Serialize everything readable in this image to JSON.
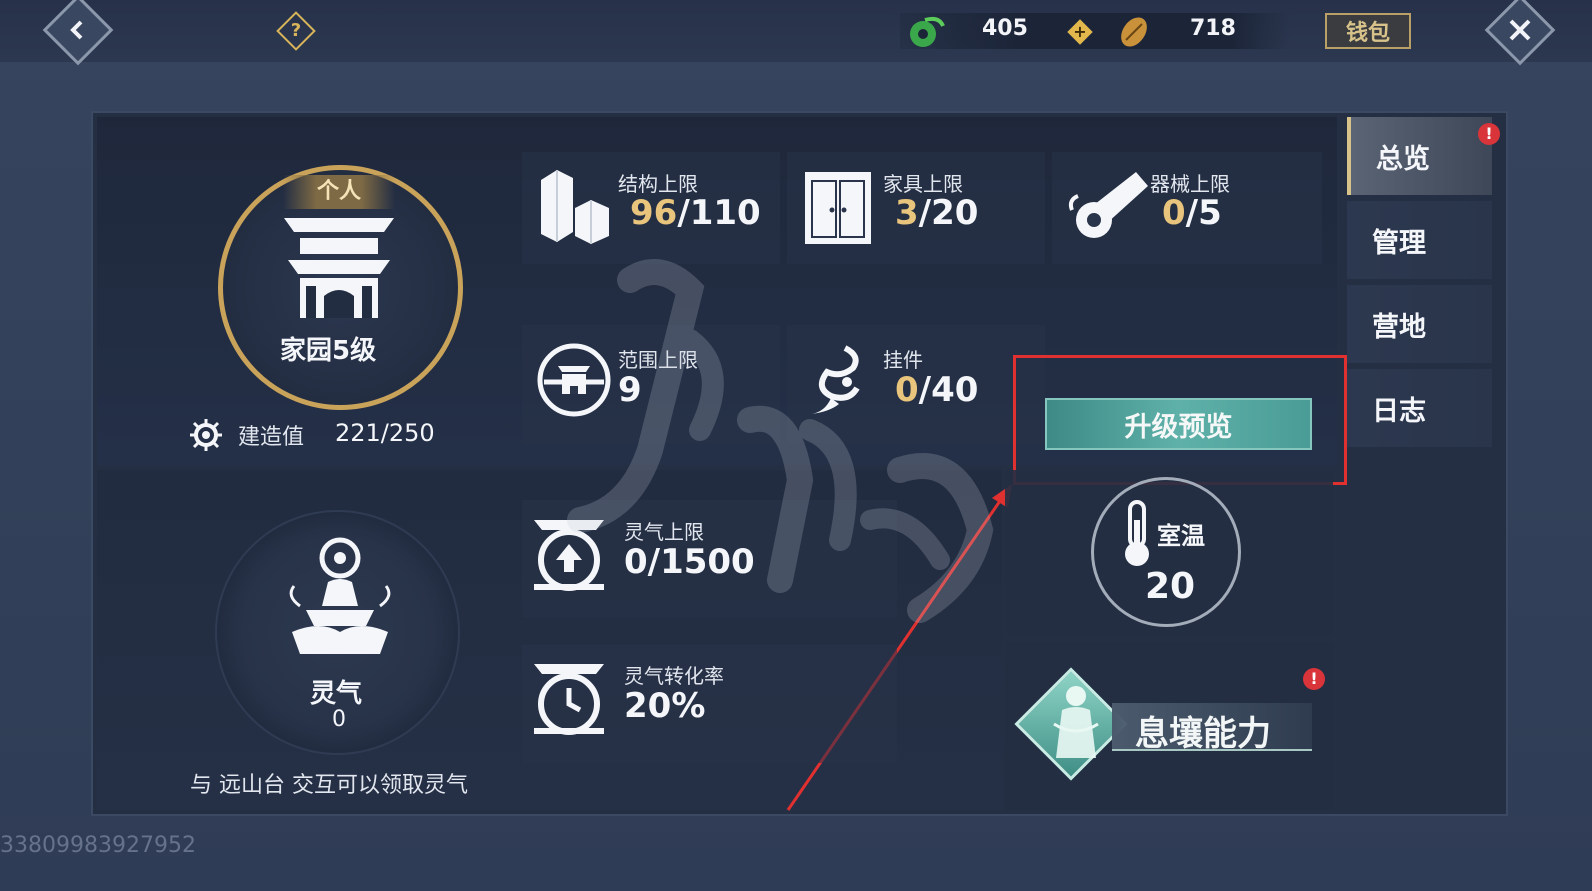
{
  "currency": {
    "jade": "405",
    "coin": "718",
    "wallet_label": "钱包"
  },
  "home": {
    "tag": "个人",
    "level_label": "家园5级",
    "build_label": "建造值",
    "build_value": "221/250"
  },
  "stats": {
    "structure": {
      "label": "结构上限",
      "current": "96",
      "max": "/110"
    },
    "furniture": {
      "label": "家具上限",
      "current": "3",
      "max": "/20"
    },
    "machine": {
      "label": "器械上限",
      "current": "0",
      "max": "/5"
    },
    "range": {
      "label": "范围上限",
      "value": "9"
    },
    "pendant": {
      "label": "挂件",
      "current": "0",
      "max": "/40"
    },
    "aura_cap": {
      "label": "灵气上限",
      "value": "0/1500"
    },
    "aura_rate": {
      "label": "灵气转化率",
      "value": "20%"
    }
  },
  "aura": {
    "label": "灵气",
    "value": "0",
    "hint": "与 远山台 交互可以领取灵气"
  },
  "upgrade_preview_label": "升级预览",
  "temperature": {
    "label": "室温",
    "value": "20"
  },
  "ability_label": "息壤能力",
  "tabs": [
    "总览",
    "管理",
    "营地",
    "日志"
  ],
  "footer_id": "33809983927952",
  "colors": {
    "accent_gold": "#e8c47c",
    "upgrade_teal": "#5eb1a9",
    "alert_red": "#d8343a",
    "highlight_red": "#e03030"
  }
}
